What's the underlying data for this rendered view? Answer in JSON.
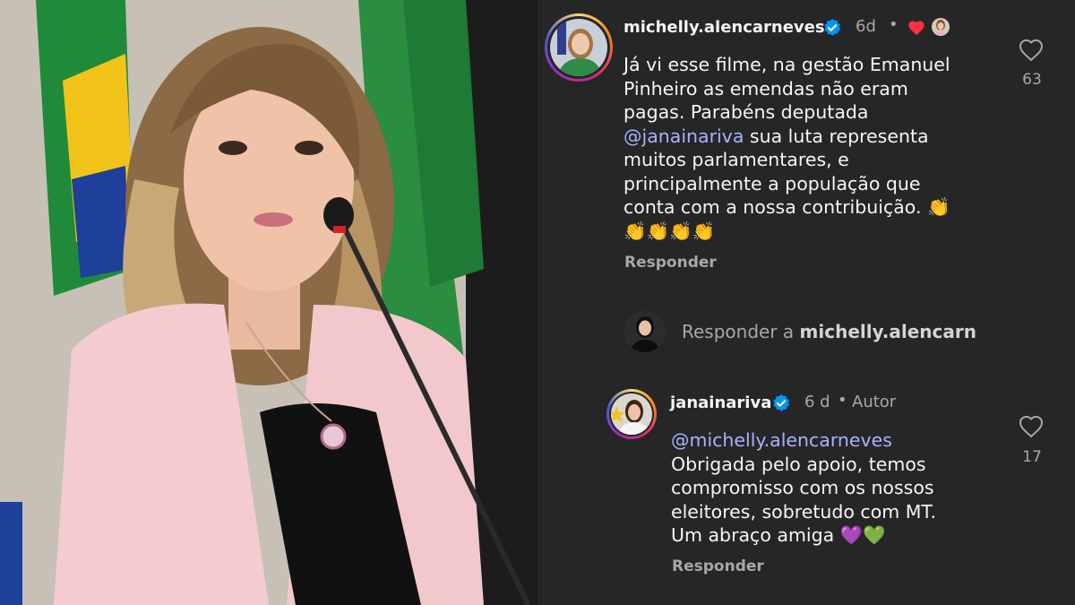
{
  "comment1": {
    "username": "michelly.alencarneves",
    "time": "6d",
    "likes": "63",
    "text_lines": [
      "Já vi esse filme, na gestão Emanuel",
      "Pinheiro as emendas não eram",
      "pagas. Parabéns deputada",
      "sua luta representa",
      "muitos parlamentares, e",
      "principalmente a população que",
      "conta com a nossa contribuição."
    ],
    "mention": "@janainariva",
    "clap_line": "👏👏👏👏",
    "clap_inline": "👏",
    "reply_label": "Responder"
  },
  "reply_input": {
    "prefix": "Responder a",
    "target": "michelly.alencarn"
  },
  "comment2": {
    "username": "janainariva",
    "time": "6 d",
    "author_badge": "Autor",
    "likes": "17",
    "mention": "@michelly.alencarneves",
    "text_lines": [
      "Obrigada pelo apoio, temos",
      "compromisso com os nossos",
      "eleitores, sobretudo com MT.",
      "Um abraço amiga"
    ],
    "hearts": "💜💚",
    "reply_label": "Responder"
  },
  "colors": {
    "panel_bg": "#262626",
    "text": "#f5f5f5",
    "muted": "#a8a8a8",
    "verified": "#0095f6",
    "mention": "#a5b4fc",
    "like_red": "#ff3040"
  }
}
